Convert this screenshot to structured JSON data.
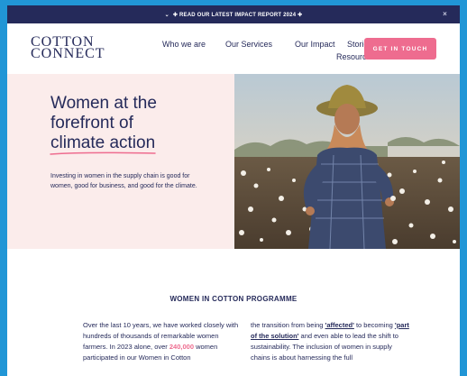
{
  "announcement": {
    "chevron": "⌄",
    "text": "✚ READ OUR LATEST IMPACT REPORT 2024 ✚",
    "close": "×"
  },
  "logo": {
    "line1": "COTTON",
    "line2": "CONNECT"
  },
  "nav": {
    "items": [
      "Who we are",
      "Our Services",
      "Our Impact",
      "Stories",
      "Resources"
    ],
    "cta": "GET IN TOUCH"
  },
  "hero": {
    "title_line1": "Women at the",
    "title_line2": "forefront of",
    "title_line3": "climate action",
    "subtitle": "Investing in women in the supply chain is good for women, good for business, and good for the climate."
  },
  "programme": {
    "heading": "WOMEN IN COTTON PROGRAMME",
    "left_part1": "Over the last 10 years, we have worked closely with hundreds of thousands of remarkable women farmers. In 2023 alone, over ",
    "left_highlight": "240,000",
    "left_part2": " women participated in our Women in Cotton",
    "right_part1": "the transition from being ",
    "right_link1": "'affected'",
    "right_part2": " to becoming ",
    "right_link2": "'part of the solution'",
    "right_part3": " and even able to lead the shift to sustainability. The inclusion of women in supply chains is about harnessing the full"
  },
  "colors": {
    "navy": "#252a5a",
    "pink": "#ee6c8f",
    "blush": "#fbeceb",
    "border": "#2196d6"
  }
}
